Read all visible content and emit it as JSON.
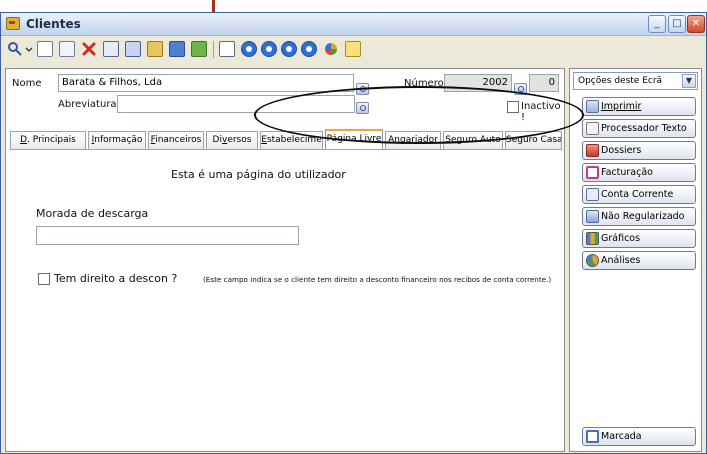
{
  "window": {
    "title": "Clientes"
  },
  "window_buttons": {
    "minimize": "_",
    "maximize": "□",
    "close": "✕"
  },
  "form": {
    "nome_label": "Nome",
    "nome_value": "Barata & Filhos, Lda",
    "numero_label": "Número",
    "numero_value": "2002",
    "numero_extra": "0",
    "abreviatura_label": "Abreviatura",
    "abreviatura_value": "",
    "inactivo_label": "Inactivo !"
  },
  "tabs": [
    {
      "label_u": "D",
      "label_rest": ". Principais"
    },
    {
      "label_u": "I",
      "label_rest": "nformação"
    },
    {
      "label_u": "F",
      "label_rest": "inanceiros"
    },
    {
      "label_pre": "Di",
      "label_u": "v",
      "label_rest": "ersos"
    },
    {
      "label_u": "E",
      "label_rest": "stabelecime"
    },
    {
      "label": "Página Livre"
    },
    {
      "label": "Angariador"
    },
    {
      "label": "Seguro Auto"
    },
    {
      "label": "Seguro Casa"
    }
  ],
  "page": {
    "heading": "Esta é uma página do utilizador",
    "morada_label": "Morada de descarga",
    "morada_value": "",
    "desconto_label": "Tem direito a descon ?",
    "desconto_note": "(Este campo indica se o cliente tem direito a desconto financeiro nos recibos de conta corrente.)"
  },
  "sidebar": {
    "dropdown": "Opções deste Ecrã",
    "buttons": [
      {
        "label": "Imprimir",
        "underline": "I"
      },
      {
        "label": "Processador Texto"
      },
      {
        "label": "Dossiers"
      },
      {
        "label": "Facturação"
      },
      {
        "label": "Conta Corrente"
      },
      {
        "label": "Não Regularizado"
      },
      {
        "label": "Gráficos"
      },
      {
        "label": "Análises"
      }
    ],
    "bottom_button": "Marcada"
  },
  "icons": {
    "toolbar": [
      "search-icon",
      "new-document-icon",
      "copy-document-icon",
      "delete-icon",
      "edit-icon",
      "table-icon",
      "open-folder-icon",
      "network-icon",
      "chart-icon",
      "print-preview-icon",
      "first-record-icon",
      "previous-record-icon",
      "next-record-icon",
      "last-record-icon",
      "refresh-icon",
      "notes-icon"
    ]
  },
  "colors": {
    "active_tab_accent": "#f2a434",
    "close_button": "#cf4a2a",
    "title_text": "#1e2d4c"
  }
}
